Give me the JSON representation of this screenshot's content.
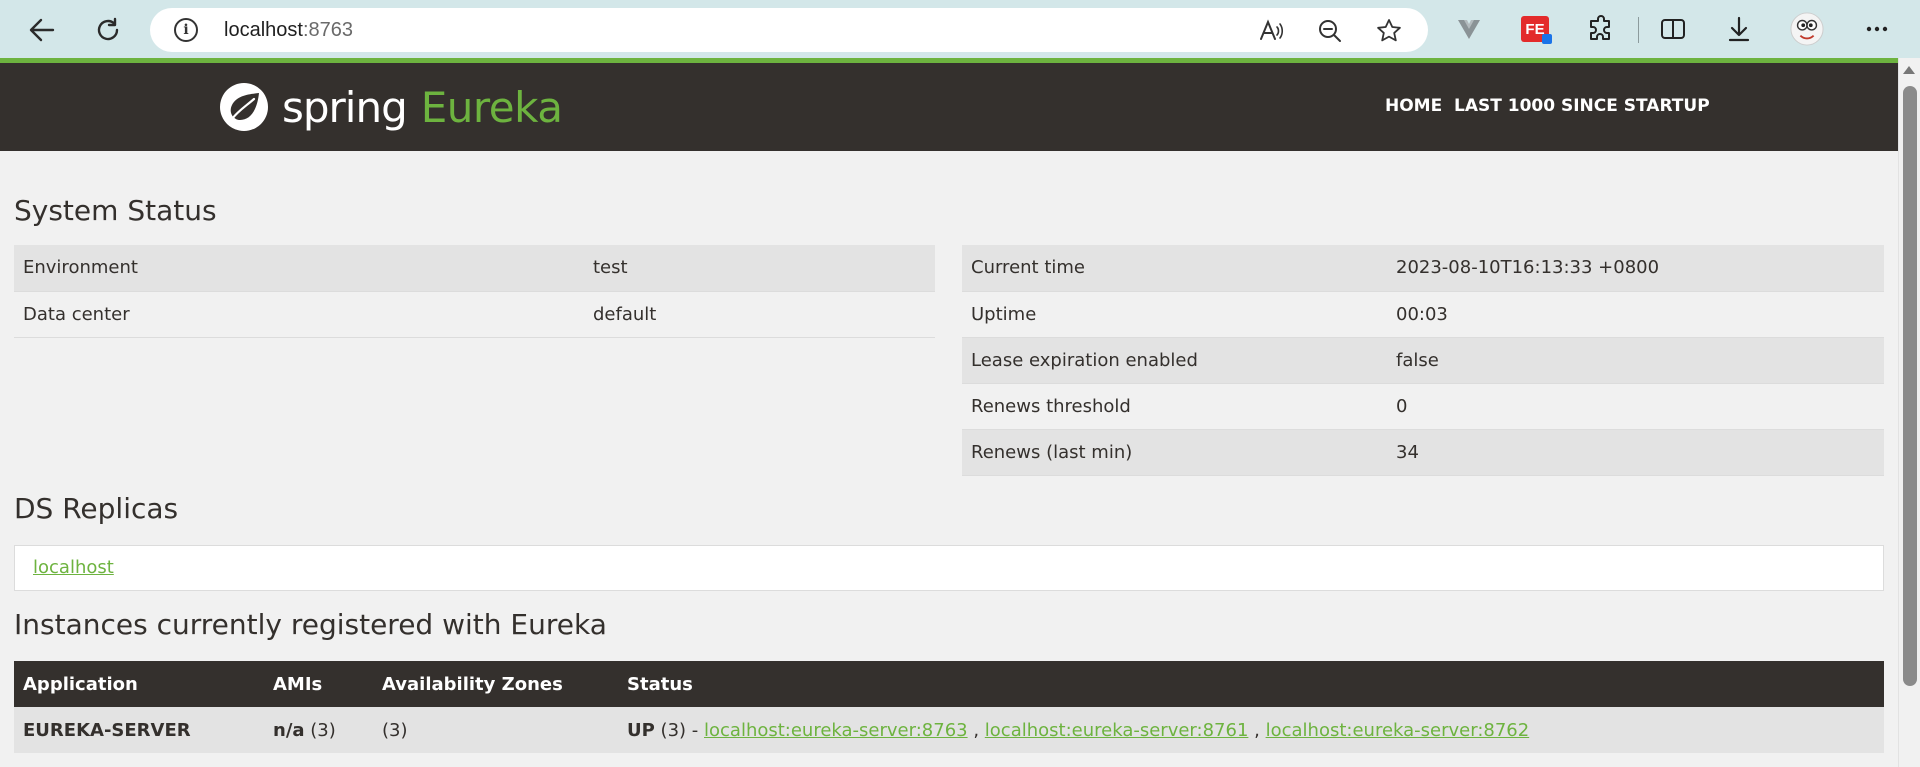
{
  "browser": {
    "url_host": "localhost",
    "url_port": ":8763",
    "colors": {
      "chrome": "#d3e7e9",
      "accent": "#6db33f"
    },
    "toolbar_icons": [
      "back-icon",
      "reload-icon",
      "info-icon",
      "read-aloud-icon",
      "zoom-out-icon",
      "favorite-star-icon",
      "vue-devtools-icon",
      "fe-extension-icon",
      "extensions-puzzle-icon",
      "split-screen-icon",
      "download-icon",
      "profile-avatar-icon",
      "more-menu-icon"
    ],
    "fe_label": "FE"
  },
  "header": {
    "logo_spring": "spring",
    "logo_eureka": "Eureka",
    "nav": {
      "home": "HOME",
      "last1000": "LAST 1000 SINCE STARTUP"
    },
    "colors": {
      "background": "#34302d",
      "brand_green": "#6db33f"
    }
  },
  "system_status": {
    "title": "System Status",
    "left": [
      {
        "key": "Environment",
        "value": "test"
      },
      {
        "key": "Data center",
        "value": "default"
      }
    ],
    "right": [
      {
        "key": "Current time",
        "value": "2023-08-10T16:13:33 +0800"
      },
      {
        "key": "Uptime",
        "value": "00:03"
      },
      {
        "key": "Lease expiration enabled",
        "value": "false"
      },
      {
        "key": "Renews threshold",
        "value": "0"
      },
      {
        "key": "Renews (last min)",
        "value": "34"
      }
    ]
  },
  "ds_replicas": {
    "title": "DS Replicas",
    "items": [
      "localhost"
    ]
  },
  "instances": {
    "title": "Instances currently registered with Eureka",
    "columns": [
      "Application",
      "AMIs",
      "Availability Zones",
      "Status"
    ],
    "rows": [
      {
        "application": "EUREKA-SERVER",
        "amis_bold": "n/a",
        "amis_count": "(3)",
        "zones": "(3)",
        "status_bold": "UP",
        "status_rest": "(3) -",
        "links": [
          "localhost:eureka-server:8763",
          "localhost:eureka-server:8761",
          "localhost:eureka-server:8762"
        ],
        "separator": ","
      }
    ]
  }
}
